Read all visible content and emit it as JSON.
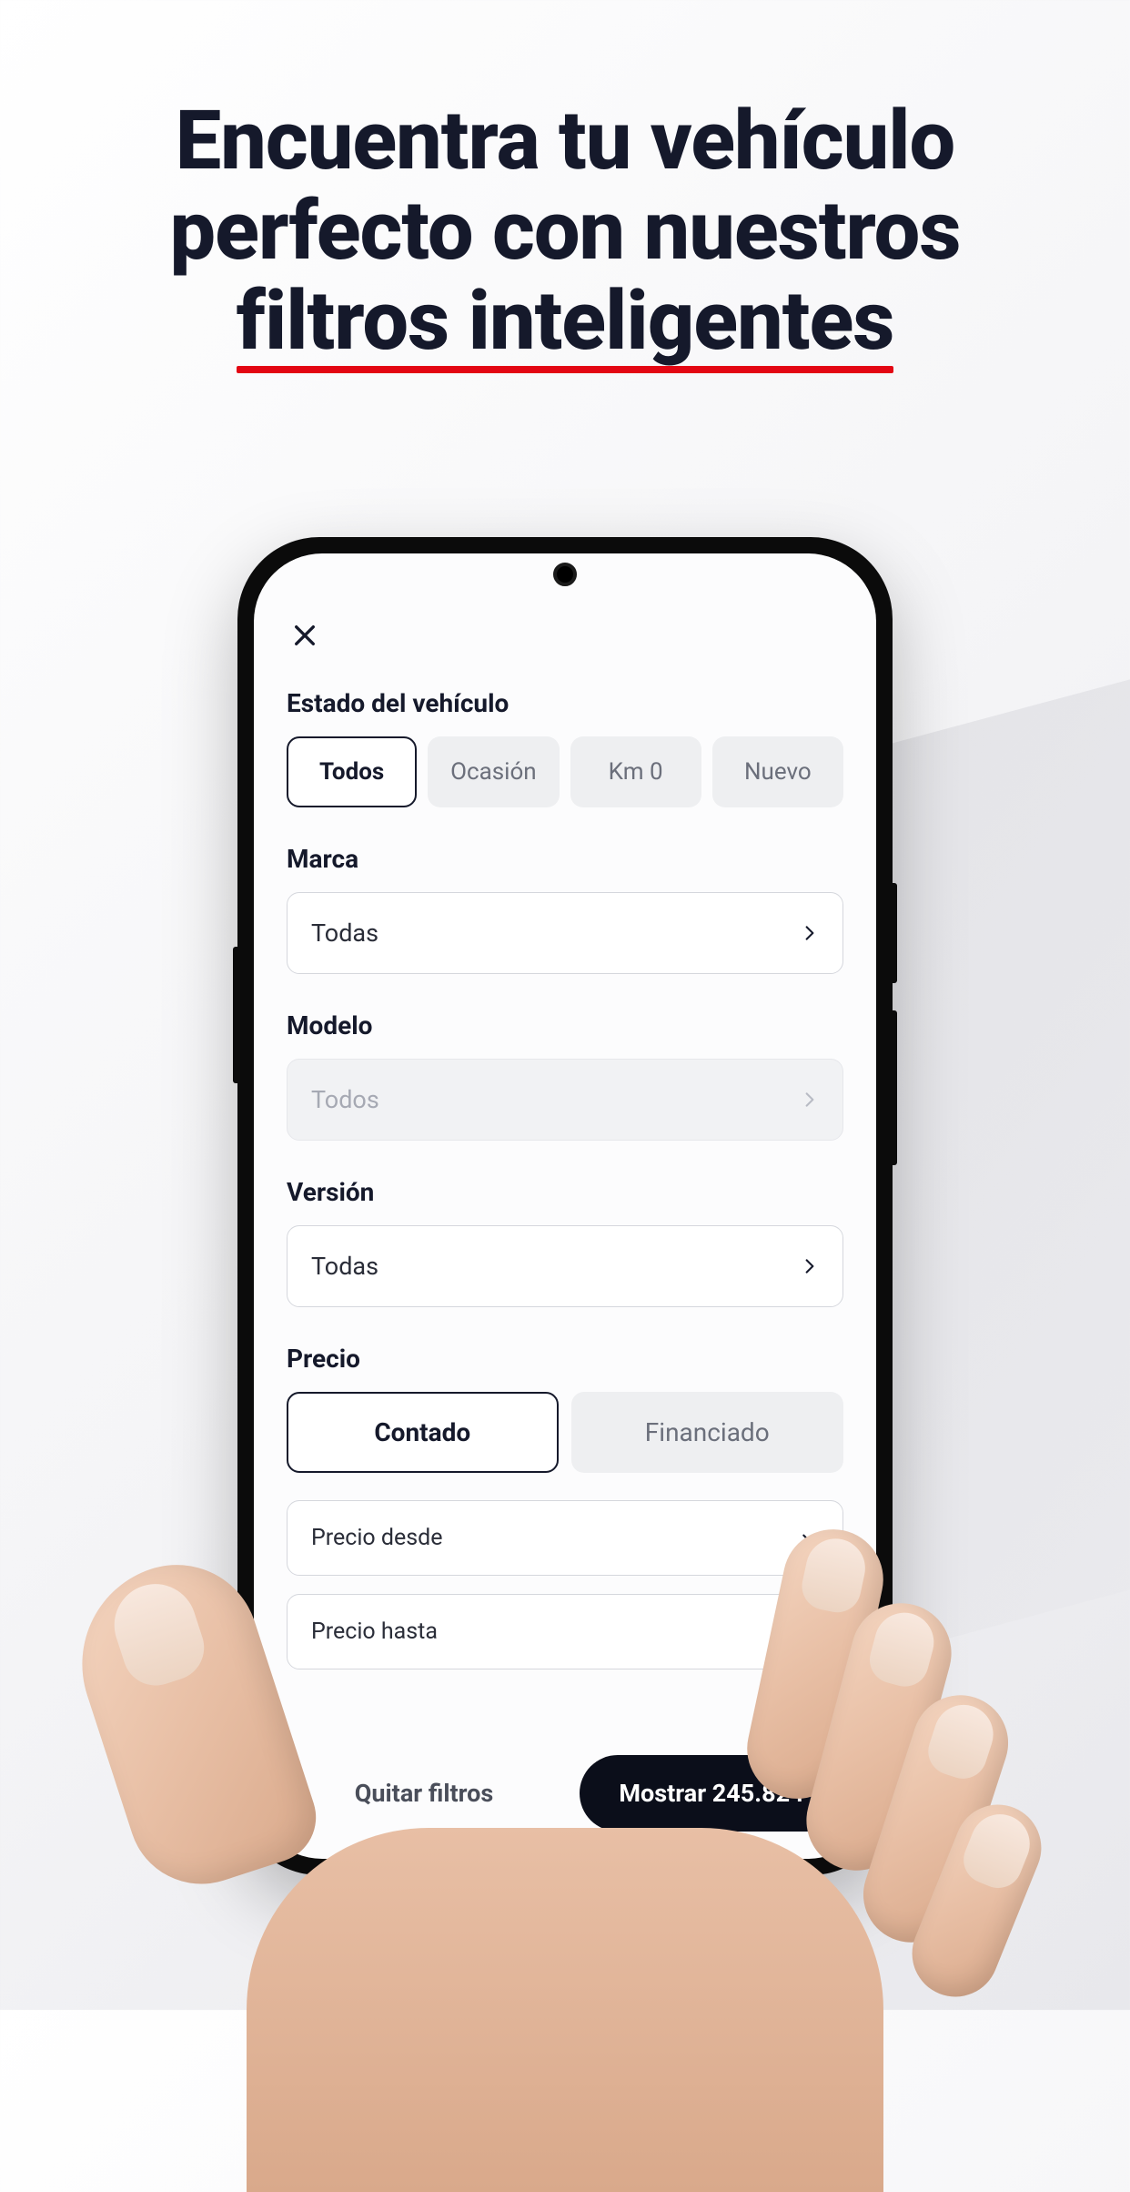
{
  "headline": {
    "line1": "Encuentra tu vehículo",
    "line2": "perfecto con nuestros",
    "line3_underlined": "filtros inteligentes"
  },
  "filters": {
    "estado": {
      "label": "Estado del vehículo",
      "options": [
        "Todos",
        "Ocasión",
        "Km 0",
        "Nuevo"
      ],
      "selected_index": 0
    },
    "marca": {
      "label": "Marca",
      "value": "Todas"
    },
    "modelo": {
      "label": "Modelo",
      "value": "Todos",
      "disabled": true
    },
    "version": {
      "label": "Versión",
      "value": "Todas"
    },
    "precio": {
      "label": "Precio",
      "tabs": [
        "Contado",
        "Financiado"
      ],
      "selected_tab": 0,
      "desde_label": "Precio desde",
      "hasta_label": "Precio hasta"
    }
  },
  "footer": {
    "clear": "Quitar filtros",
    "show": "Mostrar 245.824"
  }
}
